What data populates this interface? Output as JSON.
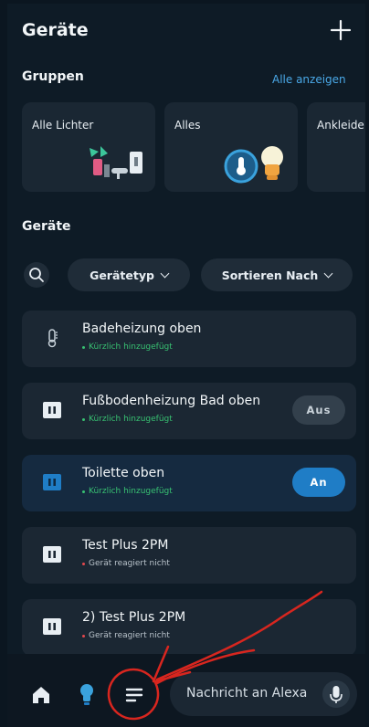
{
  "header": {
    "title": "Geräte"
  },
  "groups": {
    "title": "Gruppen",
    "show_all": "Alle anzeigen",
    "items": [
      {
        "label": "Alle Lichter"
      },
      {
        "label": "Alles"
      },
      {
        "label": "Ankleide"
      }
    ]
  },
  "devices_section": {
    "title": "Geräte",
    "filter_type": "Gerätetyp",
    "sort": "Sortieren Nach"
  },
  "devices": [
    {
      "name": "Badeheizung oben",
      "status": "Kürzlich hinzugefügt",
      "status_color": "#38c172",
      "icon": "thermometer-icon",
      "toggle": "",
      "state": "none"
    },
    {
      "name": "Fußbodenheizung Bad oben",
      "status": "Kürzlich hinzugefügt",
      "status_color": "#38c172",
      "icon": "plug-icon",
      "toggle": "Aus",
      "state": "off"
    },
    {
      "name": "Toilette oben",
      "status": "Kürzlich hinzugefügt",
      "status_color": "#38c172",
      "icon": "plug-icon",
      "toggle": "An",
      "state": "on"
    },
    {
      "name": "Test Plus 2PM",
      "status": "Gerät reagiert nicht",
      "status_color": "#e5484d",
      "icon": "plug-icon",
      "toggle": "",
      "state": "unresponsive"
    },
    {
      "name": "2) Test Plus 2PM",
      "status": "Gerät reagiert nicht",
      "status_color": "#e5484d",
      "icon": "plug-icon",
      "toggle": "",
      "state": "unresponsive"
    }
  ],
  "bottom_nav": {
    "items": [
      "home-icon",
      "bulb-icon",
      "menu-icon"
    ],
    "alexa_placeholder": "Nachricht an Alexa"
  },
  "colors": {
    "accent": "#4aa9e8",
    "toggle_on": "#1f7dc6",
    "annotation": "#d8261f"
  }
}
